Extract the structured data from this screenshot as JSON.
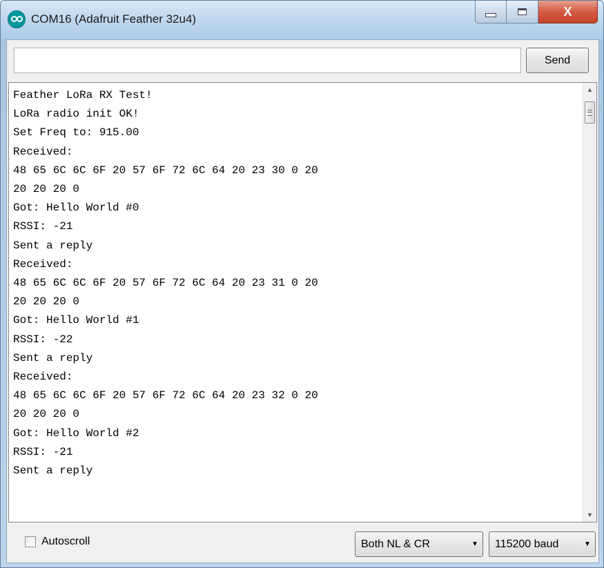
{
  "window": {
    "title": "COM16 (Adafruit Feather 32u4)",
    "app_icon": "arduino-logo-icon",
    "caption_buttons": [
      "minimize-icon",
      "maximize-icon",
      "close-icon"
    ],
    "close_glyph": "X"
  },
  "send_bar": {
    "input_value": "",
    "send_label": "Send"
  },
  "output": {
    "lines": [
      "Feather LoRa RX Test!",
      "LoRa radio init OK!",
      "Set Freq to: 915.00",
      "Received:",
      "48 65 6C 6C 6F 20 57 6F 72 6C 64 20 23 30 0 20",
      "20 20 20 0",
      "Got: Hello World #0",
      "RSSI: -21",
      "Sent a reply",
      "Received:",
      "48 65 6C 6C 6F 20 57 6F 72 6C 64 20 23 31 0 20",
      "20 20 20 0",
      "Got: Hello World #1",
      "RSSI: -22",
      "Sent a reply",
      "Received:",
      "48 65 6C 6C 6F 20 57 6F 72 6C 64 20 23 32 0 20",
      "20 20 20 0",
      "Got: Hello World #2",
      "RSSI: -21",
      "Sent a reply"
    ]
  },
  "footer": {
    "autoscroll_label": "Autoscroll",
    "autoscroll_checked": false,
    "line_ending": "Both NL & CR",
    "baud_rate": "115200 baud"
  }
}
